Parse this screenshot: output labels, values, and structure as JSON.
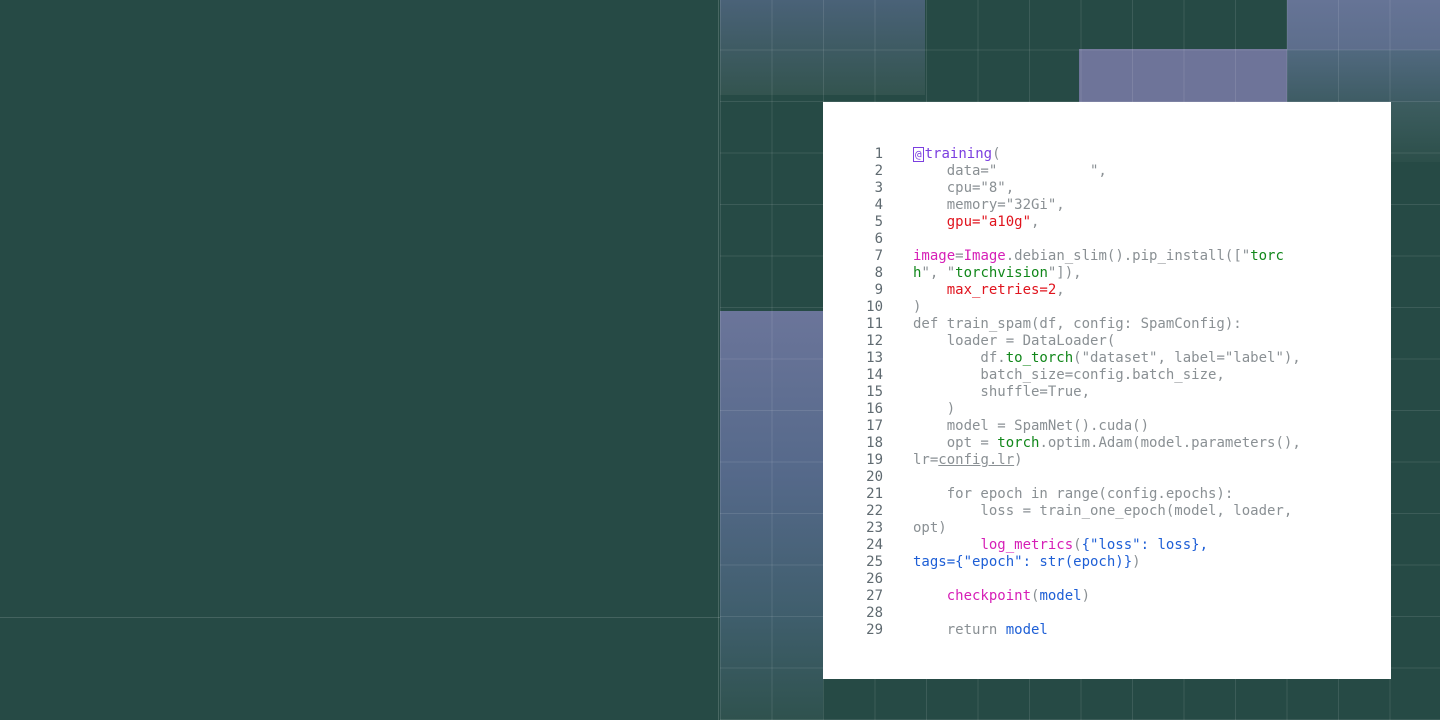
{
  "code": {
    "lines": [
      {
        "n": "1",
        "segments": [
          {
            "t": "@",
            "c": "at"
          },
          {
            "t": "training",
            "c": "purple"
          },
          {
            "t": "(",
            "c": "plain"
          }
        ]
      },
      {
        "n": "2",
        "segments": [
          {
            "t": "    data=\"           \",",
            "c": "plain"
          }
        ]
      },
      {
        "n": "3",
        "segments": [
          {
            "t": "    cpu=\"8\",",
            "c": "plain"
          }
        ]
      },
      {
        "n": "4",
        "segments": [
          {
            "t": "    memory=\"32Gi\",",
            "c": "plain"
          }
        ]
      },
      {
        "n": "5",
        "segments": [
          {
            "t": "    ",
            "c": "plain"
          },
          {
            "t": "gpu=\"a10g\"",
            "c": "red"
          },
          {
            "t": ",",
            "c": "plain"
          }
        ]
      },
      {
        "n": "6",
        "segments": []
      },
      {
        "n": "7",
        "segments": [
          {
            "t": "image",
            "c": "magenta"
          },
          {
            "t": "=",
            "c": "plain"
          },
          {
            "t": "Image",
            "c": "magenta"
          },
          {
            "t": ".debian_slim().pip_install([\"",
            "c": "plain"
          },
          {
            "t": "torc",
            "c": "green"
          }
        ]
      },
      {
        "n": "8",
        "segments": [
          {
            "t": "h",
            "c": "green"
          },
          {
            "t": "\", \"",
            "c": "plain"
          },
          {
            "t": "torchvision",
            "c": "green"
          },
          {
            "t": "\"]),",
            "c": "plain"
          }
        ]
      },
      {
        "n": "9",
        "segments": [
          {
            "t": "    ",
            "c": "plain"
          },
          {
            "t": "max_retries=2",
            "c": "red"
          },
          {
            "t": ",",
            "c": "plain"
          }
        ]
      },
      {
        "n": "10",
        "segments": [
          {
            "t": ")",
            "c": "plain"
          }
        ]
      },
      {
        "n": "11",
        "segments": [
          {
            "t": "def train_spam(df, config: SpamConfig):",
            "c": "plain"
          }
        ]
      },
      {
        "n": "12",
        "segments": [
          {
            "t": "    loader = DataLoader(",
            "c": "plain"
          }
        ]
      },
      {
        "n": "13",
        "segments": [
          {
            "t": "        df.",
            "c": "plain"
          },
          {
            "t": "to_torch",
            "c": "green"
          },
          {
            "t": "(\"dataset\", label=\"label\"),",
            "c": "plain"
          }
        ]
      },
      {
        "n": "14",
        "segments": [
          {
            "t": "        batch_size=config.batch_size,",
            "c": "plain"
          }
        ]
      },
      {
        "n": "15",
        "segments": [
          {
            "t": "        shuffle=True,",
            "c": "plain"
          }
        ]
      },
      {
        "n": "16",
        "segments": [
          {
            "t": "    )",
            "c": "plain"
          }
        ]
      },
      {
        "n": "17",
        "segments": [
          {
            "t": "    model = SpamNet().cuda()",
            "c": "plain"
          }
        ]
      },
      {
        "n": "18",
        "segments": [
          {
            "t": "    opt = ",
            "c": "plain"
          },
          {
            "t": "torch",
            "c": "green"
          },
          {
            "t": ".optim.Adam(model.parameters(),",
            "c": "plain"
          }
        ]
      },
      {
        "n": "19",
        "segments": [
          {
            "t": "lr=",
            "c": "plain"
          },
          {
            "t": "config.lr",
            "c": "ul"
          },
          {
            "t": ")",
            "c": "plain"
          }
        ]
      },
      {
        "n": "20",
        "segments": []
      },
      {
        "n": "21",
        "segments": [
          {
            "t": "    for epoch in range(config.epochs):",
            "c": "plain"
          }
        ]
      },
      {
        "n": "22",
        "segments": [
          {
            "t": "        loss = train_one_epoch(model, loader,",
            "c": "plain"
          }
        ]
      },
      {
        "n": "23",
        "segments": [
          {
            "t": "opt)",
            "c": "plain"
          }
        ]
      },
      {
        "n": "24",
        "segments": [
          {
            "t": "        ",
            "c": "plain"
          },
          {
            "t": "log_metrics",
            "c": "magenta"
          },
          {
            "t": "(",
            "c": "plain"
          },
          {
            "t": "{\"loss\": loss},",
            "c": "blue"
          }
        ]
      },
      {
        "n": "25",
        "segments": [
          {
            "t": "tags={\"epoch\": str(epoch)}",
            "c": "blue"
          },
          {
            "t": ")",
            "c": "plain"
          }
        ]
      },
      {
        "n": "26",
        "segments": []
      },
      {
        "n": "27",
        "segments": [
          {
            "t": "    ",
            "c": "plain"
          },
          {
            "t": "checkpoint",
            "c": "magenta"
          },
          {
            "t": "(",
            "c": "plain"
          },
          {
            "t": "model",
            "c": "blue"
          },
          {
            "t": ")",
            "c": "plain"
          }
        ]
      },
      {
        "n": "28",
        "segments": []
      },
      {
        "n": "29",
        "segments": [
          {
            "t": "    return ",
            "c": "plain"
          },
          {
            "t": "model",
            "c": "blue"
          }
        ]
      }
    ]
  }
}
